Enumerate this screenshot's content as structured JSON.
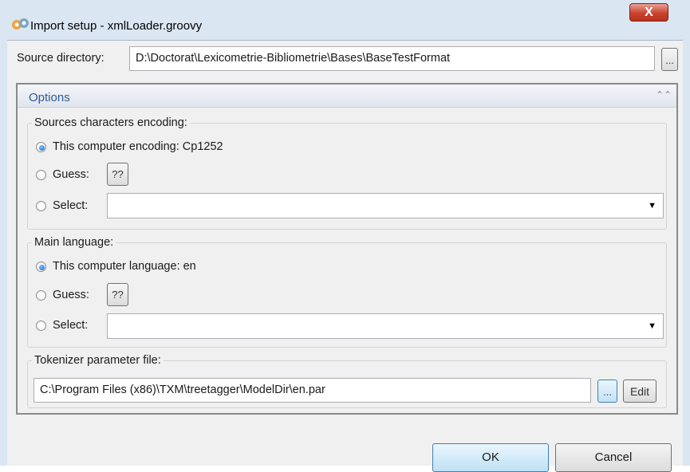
{
  "window": {
    "title": "Import setup - xmlLoader.groovy",
    "close_glyph": "X",
    "icon": "groovy-app-icon"
  },
  "source": {
    "label": "Source directory:",
    "value": "D:\\Doctorat\\Lexicometrie-Bibliometrie\\Bases\\BaseTestFormat",
    "browse_label": "..."
  },
  "options": {
    "title": "Options",
    "collapse_glyph": "⌃⌃"
  },
  "encoding": {
    "title": "Sources characters encoding:",
    "radio_computer": "This computer encoding: Cp1252",
    "radio_guess": "Guess:",
    "guess_button": "??",
    "radio_select": "Select:",
    "select_value": "",
    "selected": "computer"
  },
  "language": {
    "title": "Main language:",
    "radio_computer": "This computer language: en",
    "radio_guess": "Guess:",
    "guess_button": "??",
    "radio_select": "Select:",
    "select_value": "",
    "selected": "computer"
  },
  "tokenizer": {
    "title": "Tokenizer parameter file:",
    "value": "C:\\Program Files (x86)\\TXM\\treetagger\\ModelDir\\en.par",
    "browse_label": "...",
    "edit_label": "Edit"
  },
  "buttons": {
    "ok": "OK",
    "cancel": "Cancel"
  },
  "colors": {
    "title_bar": "#dbe6f3",
    "options_header_text": "#2d5a96",
    "close_button": "#c8442f"
  }
}
